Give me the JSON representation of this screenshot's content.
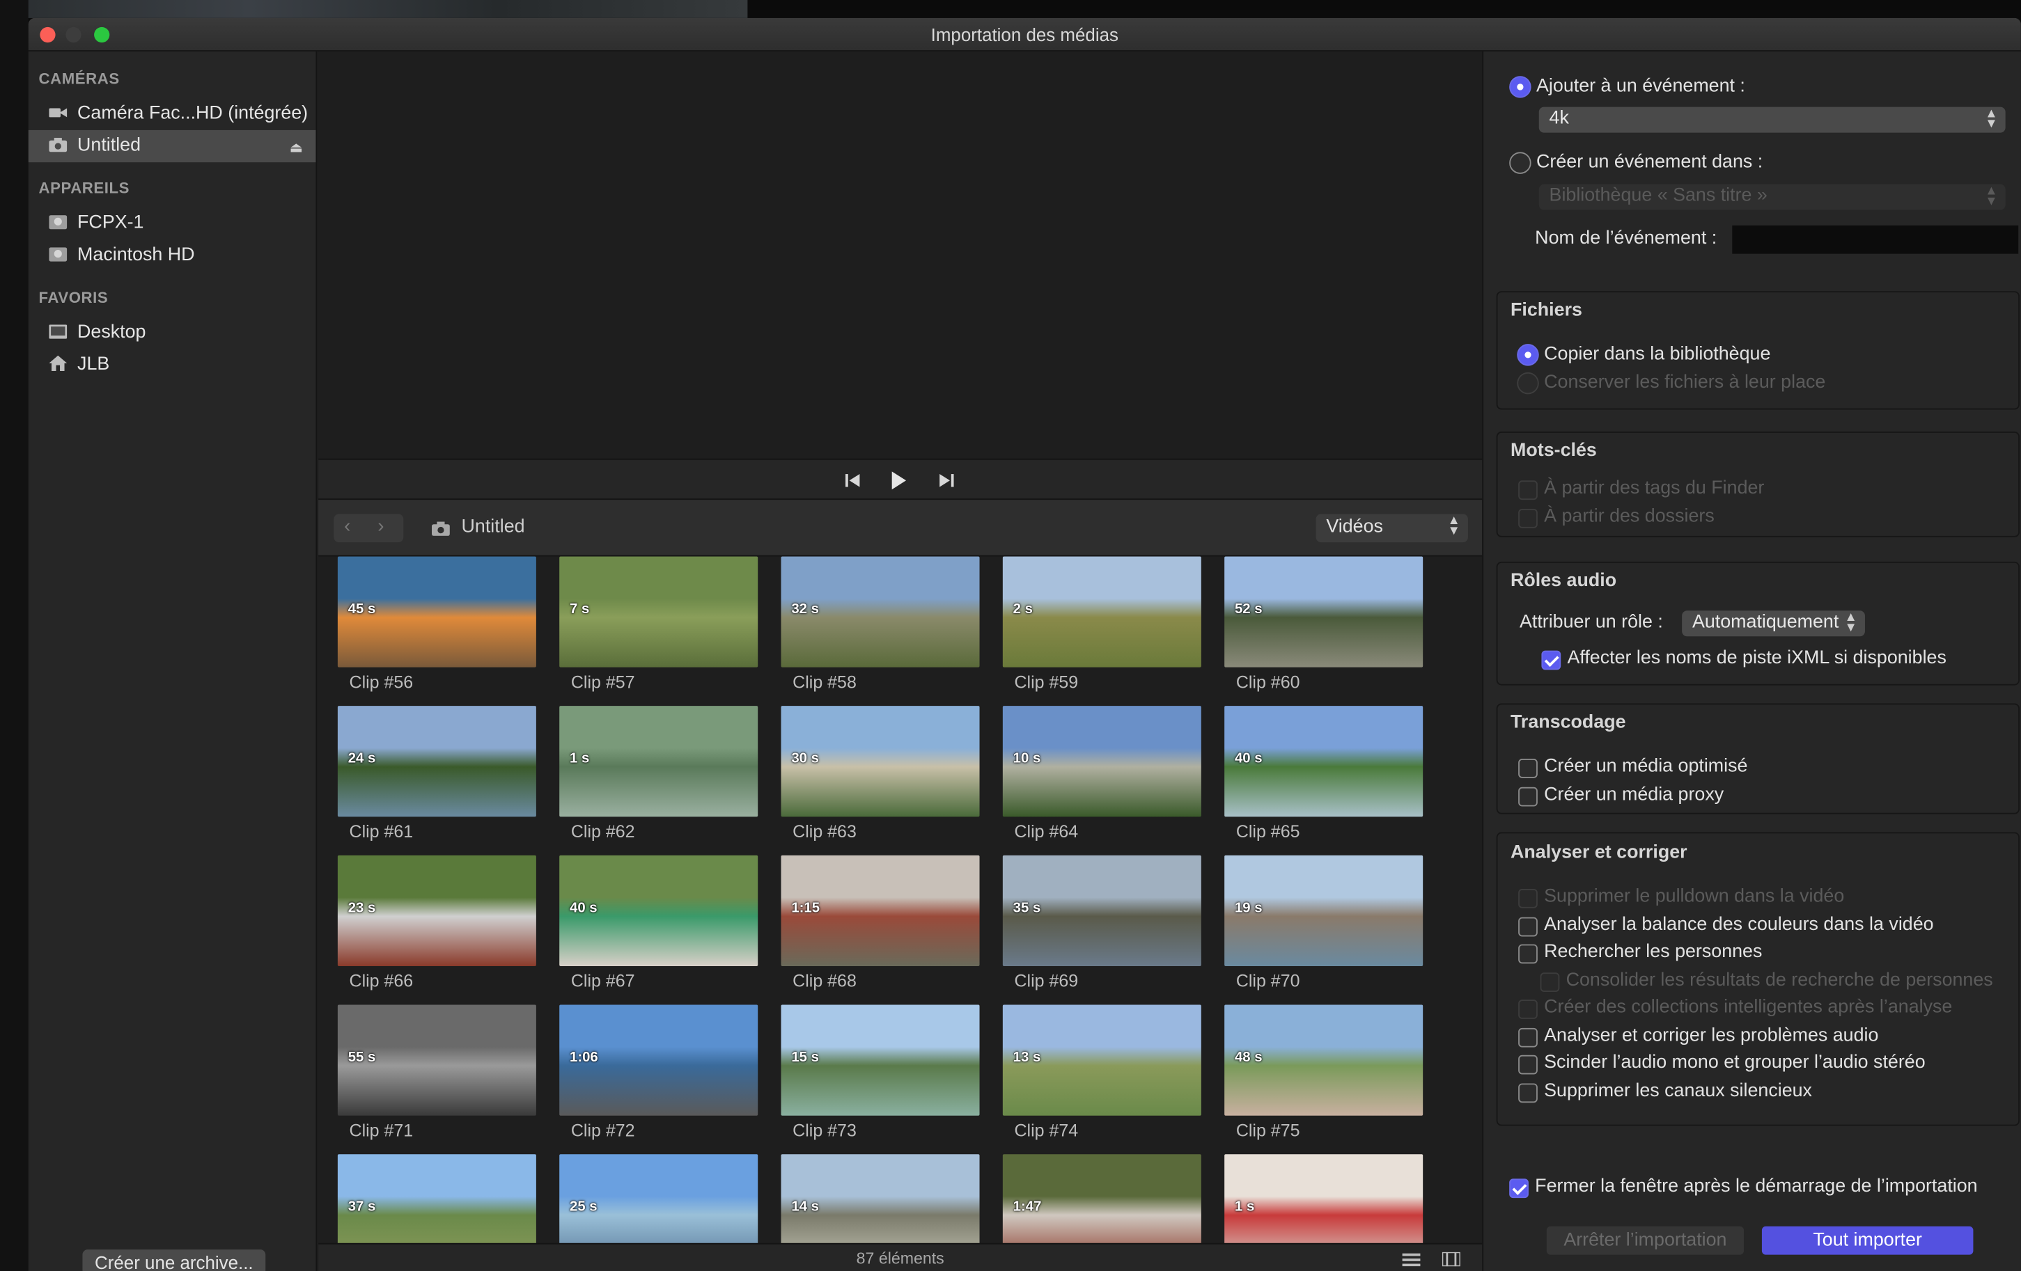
{
  "window": {
    "title": "Importation des médias"
  },
  "sidebar": {
    "cameras_heading": "CAMÉRAS",
    "cameras": [
      {
        "label": "Caméra Fac...HD (intégrée)",
        "icon": "video-camera-icon"
      },
      {
        "label": "Untitled",
        "icon": "camera-icon",
        "selected": true
      }
    ],
    "devices_heading": "APPAREILS",
    "devices": [
      {
        "label": "FCPX-1",
        "icon": "disk-icon"
      },
      {
        "label": "Macintosh HD",
        "icon": "disk-icon"
      }
    ],
    "favorites_heading": "FAVORIS",
    "favorites": [
      {
        "label": "Desktop",
        "icon": "desktop-folder-icon"
      },
      {
        "label": "JLB",
        "icon": "home-icon"
      }
    ],
    "archive_button": "Créer une archive..."
  },
  "browser": {
    "path": "Untitled",
    "filter": "Vidéos",
    "count": "87 éléments",
    "clips": [
      {
        "name": "Clip #56",
        "duration": "45 s"
      },
      {
        "name": "Clip #57",
        "duration": "7 s"
      },
      {
        "name": "Clip #58",
        "duration": "32 s"
      },
      {
        "name": "Clip #59",
        "duration": "2 s"
      },
      {
        "name": "Clip #60",
        "duration": "52 s"
      },
      {
        "name": "Clip #61",
        "duration": "24 s"
      },
      {
        "name": "Clip #62",
        "duration": "1 s"
      },
      {
        "name": "Clip #63",
        "duration": "30 s"
      },
      {
        "name": "Clip #64",
        "duration": "10 s"
      },
      {
        "name": "Clip #65",
        "duration": "40 s"
      },
      {
        "name": "Clip #66",
        "duration": "23 s"
      },
      {
        "name": "Clip #67",
        "duration": "40 s"
      },
      {
        "name": "Clip #68",
        "duration": "1:15"
      },
      {
        "name": "Clip #69",
        "duration": "35 s"
      },
      {
        "name": "Clip #70",
        "duration": "19 s"
      },
      {
        "name": "Clip #71",
        "duration": "55 s"
      },
      {
        "name": "Clip #72",
        "duration": "1:06"
      },
      {
        "name": "Clip #73",
        "duration": "15 s"
      },
      {
        "name": "Clip #74",
        "duration": "13 s"
      },
      {
        "name": "Clip #75",
        "duration": "48 s"
      },
      {
        "name": "",
        "duration": "37 s"
      },
      {
        "name": "",
        "duration": "25 s"
      },
      {
        "name": "",
        "duration": "14 s"
      },
      {
        "name": "",
        "duration": "1:47"
      },
      {
        "name": "",
        "duration": "1 s"
      }
    ]
  },
  "options": {
    "add_to_event": "Ajouter à un événement :",
    "event_value": "4k",
    "create_event_in": "Créer un événement dans :",
    "library_value": "Bibliothèque « Sans titre »",
    "event_name_label": "Nom de l’événement :",
    "event_name_value": "",
    "files": {
      "title": "Fichiers",
      "copy": "Copier dans la bibliothèque",
      "keep": "Conserver les fichiers à leur place"
    },
    "keywords": {
      "title": "Mots-clés",
      "finder_tags": "À partir des tags du Finder",
      "folders": "À partir des dossiers"
    },
    "audio_roles": {
      "title": "Rôles audio",
      "assign_label": "Attribuer un rôle :",
      "assign_value": "Automatiquement",
      "ixml": "Affecter les noms de piste iXML si disponibles"
    },
    "transcoding": {
      "title": "Transcodage",
      "optimized": "Créer un média optimisé",
      "proxy": "Créer un média proxy"
    },
    "analyze": {
      "title": "Analyser et corriger",
      "pulldown": "Supprimer le pulldown dans la vidéo",
      "color_balance": "Analyser la balance des couleurs dans la vidéo",
      "find_people": "Rechercher les personnes",
      "consolidate": "Consolider les résultats de recherche de personnes",
      "smart_collections": "Créer des collections intelligentes après l’analyse",
      "audio_problems": "Analyser et corriger les problèmes audio",
      "split_mono": "Scinder l’audio mono et grouper l’audio stéréo",
      "silent_channels": "Supprimer les canaux silencieux"
    },
    "close_window": "Fermer la fenêtre après le démarrage de l’importation",
    "stop_import": "Arrêter l’importation",
    "import_all": "Tout importer"
  },
  "colors": {
    "accent": "#5b5bf0",
    "window_bg": "#1e1e1e",
    "panel_bg": "#262626"
  }
}
